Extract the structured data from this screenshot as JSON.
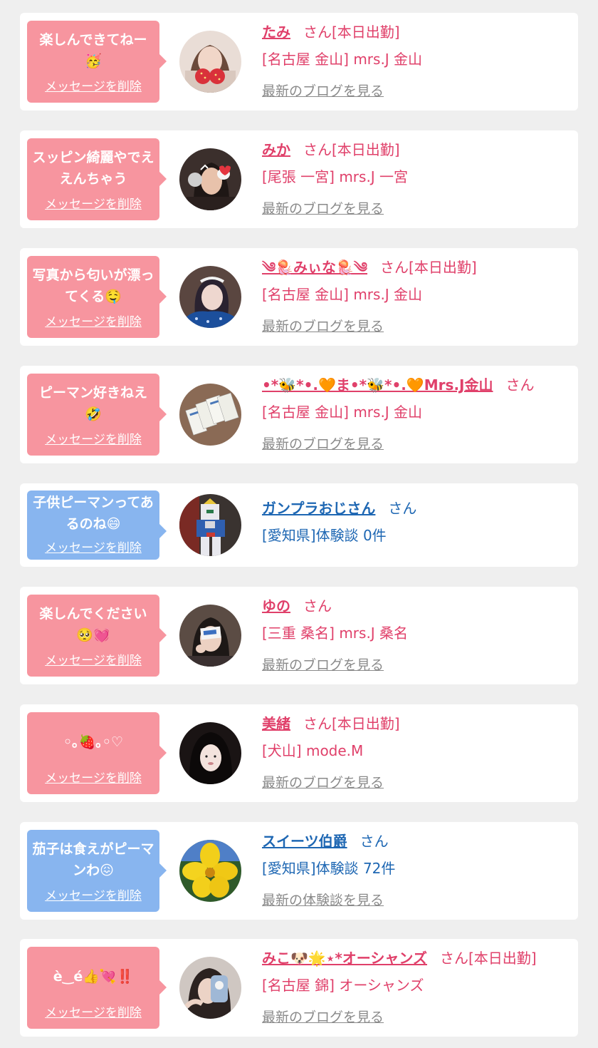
{
  "delete_label": "メッセージを削除",
  "colors": {
    "pink": "#f7959f",
    "blue": "#88b5ef",
    "pink_text": "#e0406a",
    "blue_text": "#1e67b3"
  },
  "items": [
    {
      "message": "楽しんできてねー🥳",
      "bubble": "pink",
      "name": "たみ",
      "suffix": "さん[本日出勤]",
      "location": "[名古屋 金山] mrs.J 金山",
      "link": "最新のブログを見る",
      "avatar": "woman-strawberry-filter-photo"
    },
    {
      "message": "スッピン綺麗やでええんちゃう",
      "bubble": "pink",
      "name": "みか",
      "suffix": "さん[本日出勤]",
      "location": "[尾張 一宮] mrs.J 一宮",
      "link": "最新のブログを見る",
      "avatar": "woman-dog-filter-photo"
    },
    {
      "message": "写真から匂いが漂ってくる🤤",
      "bubble": "pink",
      "name": "༄🪼みぃな🪼༄",
      "suffix": "さん[本日出勤]",
      "location": "[名古屋 金山] mrs.J 金山",
      "link": "最新のブログを見る",
      "avatar": "woman-blue-outfit-photo"
    },
    {
      "message": "ピーマン好きねえ🤣",
      "bubble": "pink",
      "name": "•*🐝*•.🧡ま•*🐝*•.🧡Mrs.J金山",
      "suffix": "さん",
      "location": "[名古屋 金山] mrs.J 金山",
      "link": "最新のブログを見る",
      "avatar": "cards-photo"
    },
    {
      "message": "子供ピーマンってあるのね😄",
      "bubble": "blue",
      "name": "ガンプラおじさん",
      "suffix": "さん",
      "location": "[愛知県]体験談 0件",
      "link": "",
      "avatar": "gundam-figure-photo"
    },
    {
      "message": "楽しんでください🥺💓",
      "bubble": "pink",
      "name": "ゆの",
      "suffix": "さん",
      "location": "[三重 桑名] mrs.J 桑名",
      "link": "最新のブログを見る",
      "avatar": "woman-card-photo"
    },
    {
      "message": "◦｡🍓｡◦♡",
      "bubble": "pink",
      "name": "美緒",
      "suffix": "さん[本日出勤]",
      "location": "[犬山] mode.M",
      "link": "最新のブログを見る",
      "avatar": "woman-dark-hair-photo"
    },
    {
      "message": "茄子は食えがピーマンわ😖",
      "bubble": "blue",
      "name": "スイーツ伯爵",
      "suffix": "さん",
      "location": "[愛知県]体験談 72件",
      "link": "最新の体験談を見る",
      "avatar": "yellow-flower-photo"
    },
    {
      "message": "è‿é👍💘‼️",
      "bubble": "pink",
      "name": "みこ🐶🌟⋆*オーシャンズ",
      "suffix": "さん[本日出勤]",
      "location": "[名古屋 錦] オーシャンズ",
      "link": "最新のブログを見る",
      "avatar": "woman-phone-case-photo"
    }
  ]
}
